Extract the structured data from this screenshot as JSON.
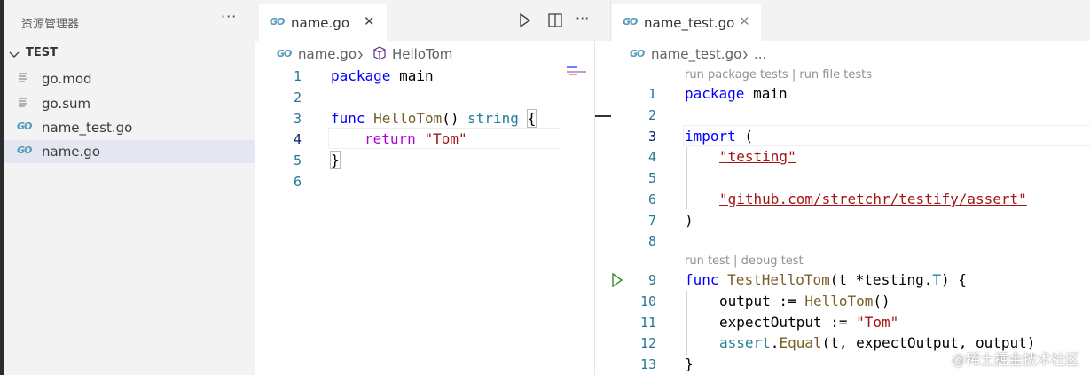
{
  "sidebar": {
    "title": "资源管理器",
    "more": "···",
    "folder": "TEST",
    "items": [
      {
        "label": "go.mod",
        "icon": "lines-icon",
        "selected": false
      },
      {
        "label": "go.sum",
        "icon": "lines-icon",
        "selected": false
      },
      {
        "label": "name_test.go",
        "icon": "go-icon",
        "selected": false
      },
      {
        "label": "name.go",
        "icon": "go-icon",
        "selected": true
      }
    ]
  },
  "go_icon_text": "GO",
  "left_editor": {
    "tab": {
      "label": "name.go",
      "close": "✕"
    },
    "breadcrumb": {
      "file": "name.go",
      "symbol": "HelloTom"
    },
    "line_numbers": [
      "1",
      "2",
      "3",
      "4",
      "5",
      "6"
    ],
    "code": {
      "l1_kw": "package",
      "l1_rest": " main",
      "l3_kw": "func",
      "l3_fn": "HelloTom",
      "l3_paren": "()",
      "l3_type": "string",
      "l3_brace": "{",
      "l4_kw": "return",
      "l4_str": "\"Tom\"",
      "l5": "}"
    }
  },
  "right_editor": {
    "tab": {
      "label": "name_test.go",
      "close": "✕"
    },
    "breadcrumb": {
      "file": "name_test.go",
      "rest": "..."
    },
    "lens_top": "run package tests | run file tests",
    "lens_mid": "run test | debug test",
    "line_numbers": [
      "1",
      "2",
      "3",
      "4",
      "5",
      "6",
      "7",
      "8",
      "9",
      "10",
      "11",
      "12",
      "13"
    ],
    "code": {
      "l1_kw": "package",
      "l1_rest": " main",
      "l3_kw": "import",
      "l3_rest": " (",
      "l4_str": "\"testing\"",
      "l6_str": "\"github.com/stretchr/testify/assert\"",
      "l7": ")",
      "l9_kw": "func",
      "l9_fn": "TestHelloTom",
      "l9_a": "(t *testing.",
      "l9_t": "T",
      "l9_b": ") {",
      "l10_a": "output := ",
      "l10_fn": "HelloTom",
      "l10_b": "()",
      "l11_a": "expectOutput := ",
      "l11_str": "\"Tom\"",
      "l12_pkg": "assert",
      "l12_dot": ".",
      "l12_fn": "Equal",
      "l12_rest": "(t, expectOutput, output)",
      "l13": "}"
    }
  },
  "watermark": "@稀土掘金技术社区",
  "colors": {
    "keyword": "#0000ff",
    "function": "#795e26",
    "string": "#a31515",
    "type": "#267f99",
    "run": "#388a34"
  }
}
